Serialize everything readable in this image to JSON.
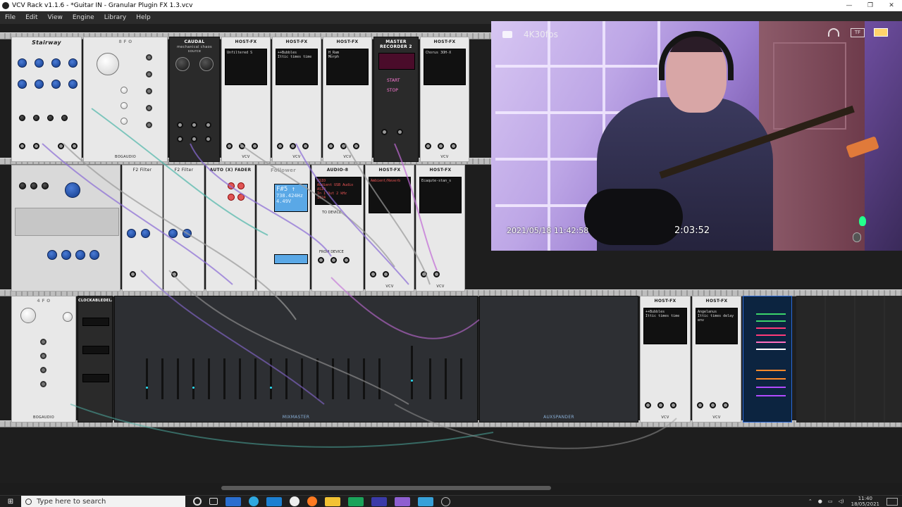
{
  "window": {
    "title": "VCV Rack v1.1.6 - *Guitar IN - Granular Plugin FX 1.3.vcv",
    "controls": [
      "—",
      "❐",
      "✕"
    ]
  },
  "menu": [
    "File",
    "Edit",
    "View",
    "Engine",
    "Library",
    "Help"
  ],
  "modules_row1": {
    "stairway": "Stairway",
    "lfo": "8 F O",
    "caudal": "CAUDAL",
    "caudal_sub": "mechanical chaos source",
    "host_fx": "HOST-FX",
    "master_recorder": "MASTER RECORDER 2",
    "recorder_start": "START",
    "recorder_stop": "STOP",
    "bogaudio": "BOGAUDIO",
    "vcv": "VCV",
    "screens": [
      "Unfiltered S",
      "++Bubbles",
      "H_Ram",
      "Chorus 3OH-X"
    ],
    "screens2": [
      "Ittic times time",
      "Morph"
    ]
  },
  "modules_row2": {
    "f2_filter": "F2 Filter",
    "auto_fader": "AUTO (X) FADER",
    "follower": "Follower",
    "audio8": "AUDIO-8",
    "host_fx": "HOST-FX",
    "follower_readout": "F#5 ↑",
    "follower_values": [
      "738.424Hz",
      "4.49V"
    ],
    "audio_screen": [
      "ASIO",
      "Audient USB Audio ASIO",
      "In 1 Out 2 kHz",
      "  1024"
    ],
    "host_screens": [
      "Ambient/Reverb",
      "Ecaqute-stan_s"
    ],
    "to_device": "TO DEVICE",
    "from_device": "FROM DEVICE",
    "vcv": "VCV"
  },
  "modules_row3": {
    "lfo": "4 F O",
    "clock": "CLOCKABLEDELAY",
    "mixmaster": "MIXMASTER",
    "auxspander": "AUXSPANDER",
    "host_fx": "HOST-FX",
    "screens": [
      "++Bubbles",
      "Ittic times time",
      "Angelanus",
      "Ittic times delay env"
    ],
    "bogaudio": "BOGAUDIO",
    "vcv": "VCV"
  },
  "webcam": {
    "resolution": "4K30fps",
    "datetime": "2021/05/18 11:42:58",
    "recording_time": "2:03:52",
    "tf_label": "TF"
  },
  "taskbar": {
    "search_placeholder": "Type here to search",
    "time": "11:40",
    "date": "18/05/2021"
  },
  "colors": {
    "cable_purple": "#8a6bd6",
    "cable_gray": "#9a9a9a",
    "cable_teal": "#4fb6a9",
    "accent_blue": "#2a66cf"
  }
}
